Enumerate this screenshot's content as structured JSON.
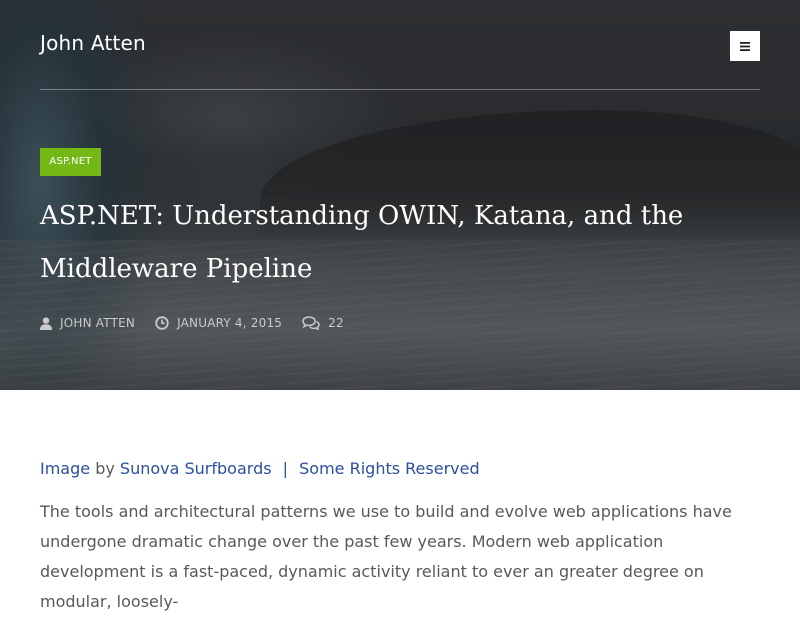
{
  "site": {
    "title": "John Atten"
  },
  "header": {
    "menu_icon": "hamburger-icon"
  },
  "post": {
    "category": "ASP.NET",
    "title": "ASP.NET: Understanding OWIN, Katana, and the Middleware Pipeline",
    "meta": {
      "author": "JOHN ATTEN",
      "date": "JANUARY 4, 2015",
      "comments": "22",
      "author_icon": "user-icon",
      "date_icon": "clock-icon",
      "comments_icon": "comments-icon"
    }
  },
  "content": {
    "credit": {
      "image_link": "Image",
      "by_text": "by",
      "source_link": "Sunova Surfboards",
      "separator": "|",
      "rights_link": "Some Rights Reserved"
    },
    "paragraph": "The tools and architectural patterns we use to build and evolve web applications have undergone dramatic change over the past few years. Modern web application development is a fast-paced, dynamic activity reliant to ever an greater degree on modular, loosely-"
  },
  "colors": {
    "accent_green": "#74b816",
    "link_blue": "#2c4f9e",
    "body_text": "#555a5e"
  }
}
